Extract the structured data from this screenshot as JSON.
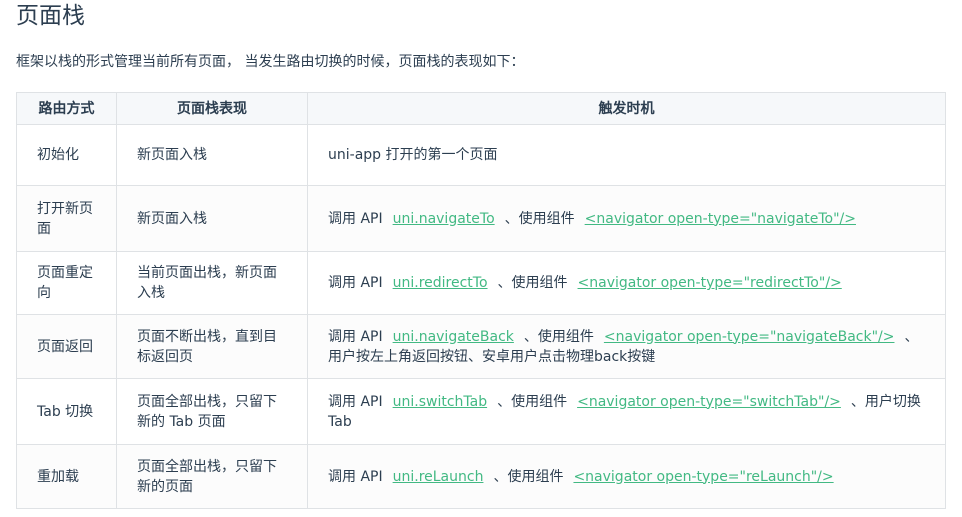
{
  "heading": "页面栈",
  "intro": "框架以栈的形式管理当前所有页面， 当发生路由切换的时候，页面栈的表现如下：",
  "table": {
    "headers": [
      "路由方式",
      "页面栈表现",
      "触发时机"
    ],
    "rows": [
      {
        "method": "初始化",
        "stack": "新页面入栈",
        "trigger": [
          {
            "text": "uni-app 打开的第一个页面"
          }
        ]
      },
      {
        "method": "打开新页面",
        "stack": "新页面入栈",
        "trigger": [
          {
            "text": "调用 API"
          },
          {
            "link": "uni.navigateTo"
          },
          {
            "text": "、使用组件"
          },
          {
            "link": "<navigator open-type=\"navigateTo\"/>"
          }
        ]
      },
      {
        "method": "页面重定向",
        "stack": "当前页面出栈，新页面入栈",
        "trigger": [
          {
            "text": "调用 API"
          },
          {
            "link": "uni.redirectTo"
          },
          {
            "text": "、使用组件"
          },
          {
            "link": "<navigator open-type=\"redirectTo\"/>"
          }
        ]
      },
      {
        "method": "页面返回",
        "stack": "页面不断出栈，直到目标返回页",
        "trigger": [
          {
            "text": "调用 API"
          },
          {
            "link": "uni.navigateBack"
          },
          {
            "text": "、使用组件"
          },
          {
            "link": "<navigator open-type=\"navigateBack\"/>"
          },
          {
            "text": "、用户按左上角返回按钮、安卓用户点击物理back按键"
          }
        ]
      },
      {
        "method": "Tab 切换",
        "stack": "页面全部出栈，只留下新的 Tab 页面",
        "trigger": [
          {
            "text": "调用 API"
          },
          {
            "link": "uni.switchTab"
          },
          {
            "text": "、使用组件"
          },
          {
            "link": "<navigator open-type=\"switchTab\"/>"
          },
          {
            "text": "、用户切换 Tab"
          }
        ]
      },
      {
        "method": "重加载",
        "stack": "页面全部出栈，只留下新的页面",
        "trigger": [
          {
            "text": "调用 API"
          },
          {
            "link": "uni.reLaunch"
          },
          {
            "text": "、使用组件"
          },
          {
            "link": "<navigator open-type=\"reLaunch\"/>"
          }
        ]
      }
    ]
  },
  "colors": {
    "text": "#2c3e50",
    "link": "#42b983",
    "border": "#dfe2e5",
    "header_bg": "#f6f8fa"
  }
}
